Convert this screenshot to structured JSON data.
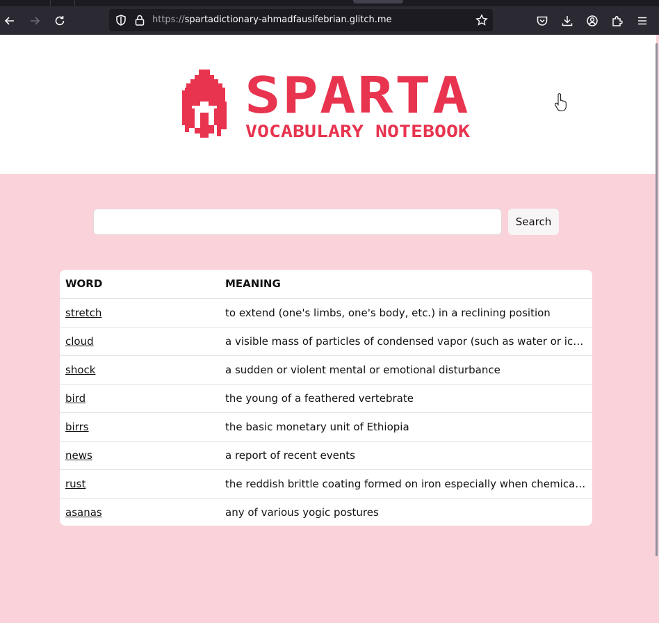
{
  "browser": {
    "url_host": "spartadictionary-ahmadfausifebrian.glitch.me",
    "url_scheme": "https://"
  },
  "header": {
    "logo_title": "SPARTA",
    "logo_subtitle": "VOCABULARY NOTEBOOK",
    "accent_color": "#e8344f"
  },
  "search": {
    "value": "",
    "button_label": "Search"
  },
  "table": {
    "columns": [
      "WORD",
      "MEANING"
    ],
    "rows": [
      {
        "word": "stretch",
        "meaning": "to extend (one's limbs, one's body, etc.) in a reclining position"
      },
      {
        "word": "cloud",
        "meaning": "a visible mass of particles of condensed vapor (such as water or ice) suspended in the atmosphere"
      },
      {
        "word": "shock",
        "meaning": "a sudden or violent mental or emotional disturbance"
      },
      {
        "word": "bird",
        "meaning": "the young of a feathered vertebrate"
      },
      {
        "word": "birrs",
        "meaning": "the basic monetary unit of Ethiopia"
      },
      {
        "word": "news",
        "meaning": "a report of recent events"
      },
      {
        "word": "rust",
        "meaning": "the reddish brittle coating formed on iron especially when chemically attacked by moist air"
      },
      {
        "word": "asanas",
        "meaning": "any of various yogic postures"
      }
    ]
  },
  "colors": {
    "page_background": "#f9d2da",
    "header_background": "#ffffff"
  }
}
